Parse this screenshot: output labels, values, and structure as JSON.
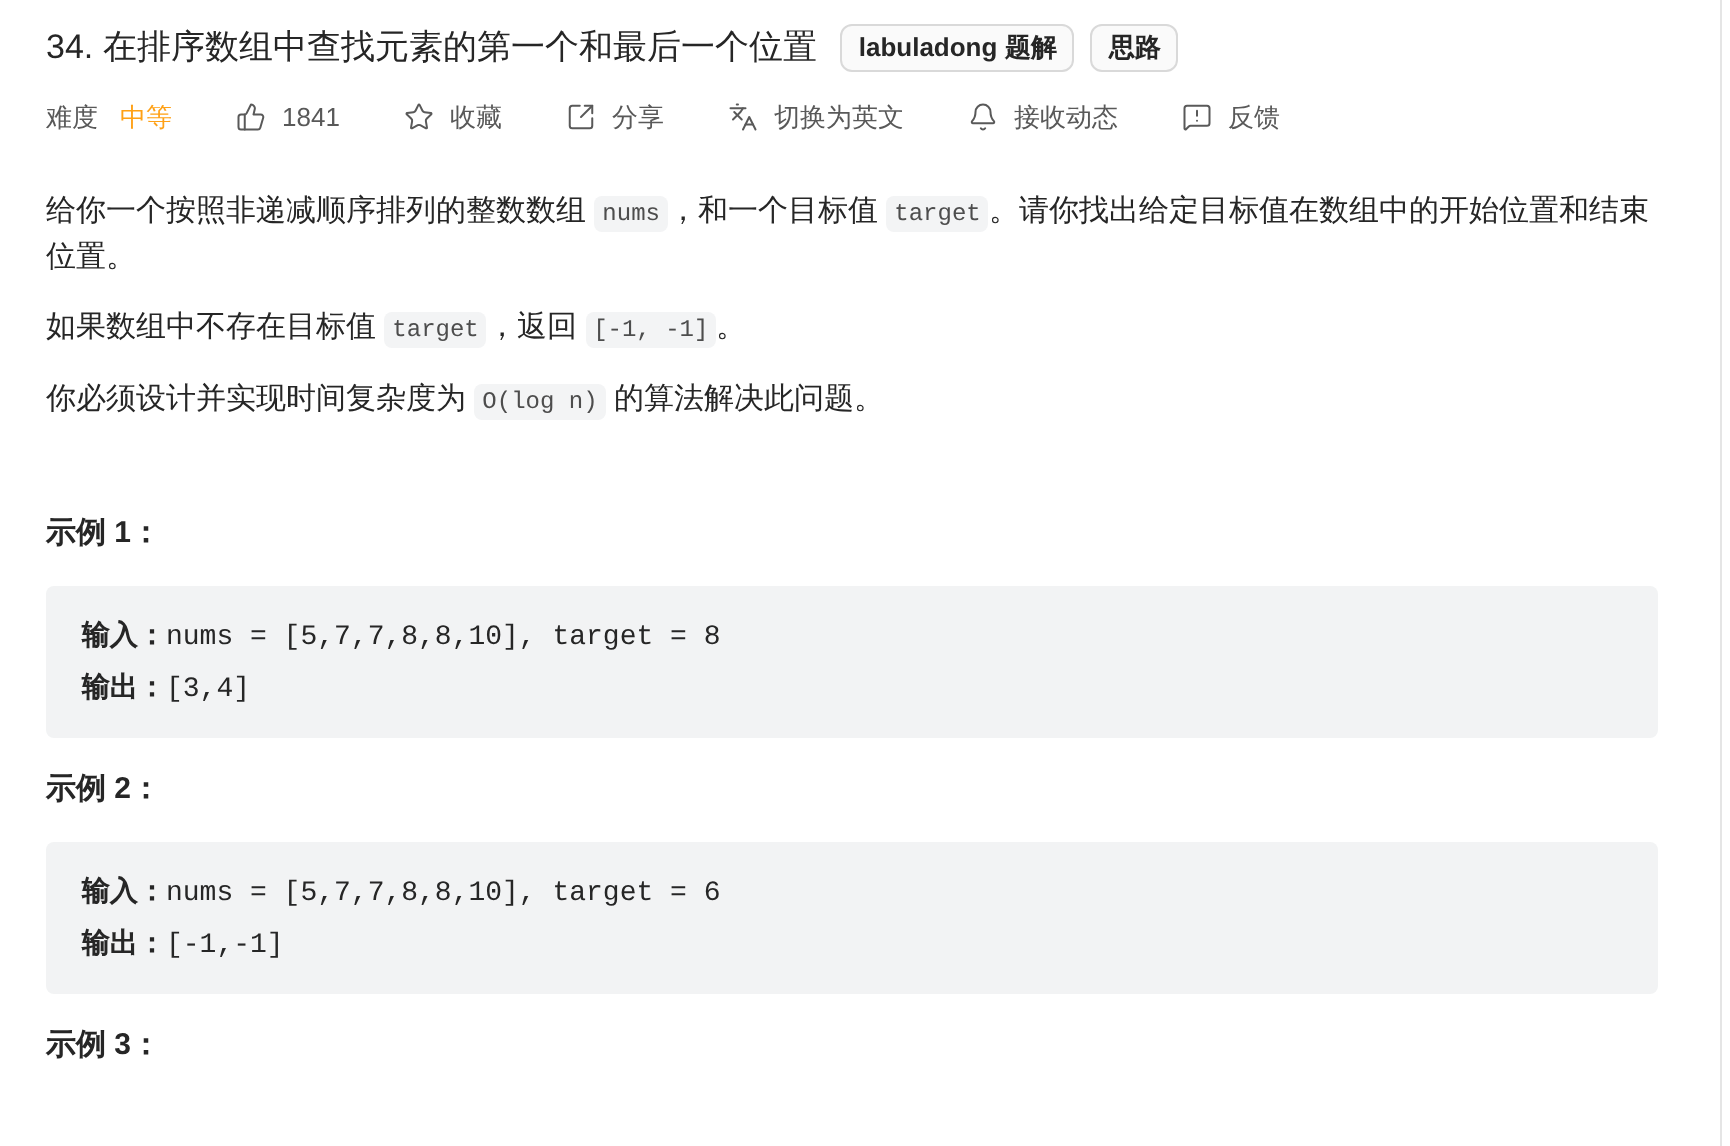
{
  "title": "34. 在排序数组中查找元素的第一个和最后一个位置",
  "tags": [
    "labuladong 题解",
    "思路"
  ],
  "difficulty": {
    "label": "难度",
    "value": "中等"
  },
  "actions": [
    {
      "kind": "like",
      "label": "1841"
    },
    {
      "kind": "star",
      "label": "收藏"
    },
    {
      "kind": "share",
      "label": "分享"
    },
    {
      "kind": "translate",
      "label": "切换为英文"
    },
    {
      "kind": "bell",
      "label": "接收动态"
    },
    {
      "kind": "feedback",
      "label": "反馈"
    }
  ],
  "paragraphs": [
    [
      {
        "kind": "text",
        "text": "给你一个按照非递减顺序排列的整数数组 "
      },
      {
        "kind": "code",
        "text": "nums"
      },
      {
        "kind": "text",
        "text": "，和一个目标值 "
      },
      {
        "kind": "code",
        "text": "target"
      },
      {
        "kind": "text",
        "text": "。请你找出给定目标值在数组中的开始位置和结束位置。"
      }
    ],
    [
      {
        "kind": "text",
        "text": "如果数组中不存在目标值 "
      },
      {
        "kind": "code",
        "text": "target"
      },
      {
        "kind": "text",
        "text": "，返回 "
      },
      {
        "kind": "code",
        "text": "[-1, -1]"
      },
      {
        "kind": "text",
        "text": "。"
      }
    ],
    [
      {
        "kind": "text",
        "text": "你必须设计并实现时间复杂度为 "
      },
      {
        "kind": "code",
        "text": "O(log n)"
      },
      {
        "kind": "text",
        "text": " 的算法解决此问题。"
      }
    ]
  ],
  "examples": [
    {
      "title": "示例 1：",
      "lines": [
        {
          "label": "输入：",
          "value": "nums = [5,7,7,8,8,10], target = 8"
        },
        {
          "label": "输出：",
          "value": "[3,4]"
        }
      ]
    },
    {
      "title": "示例 2：",
      "lines": [
        {
          "label": "输入：",
          "value": "nums = [5,7,7,8,8,10], target = 6"
        },
        {
          "label": "输出：",
          "value": "[-1,-1]"
        }
      ]
    },
    {
      "title": "示例 3："
    }
  ]
}
